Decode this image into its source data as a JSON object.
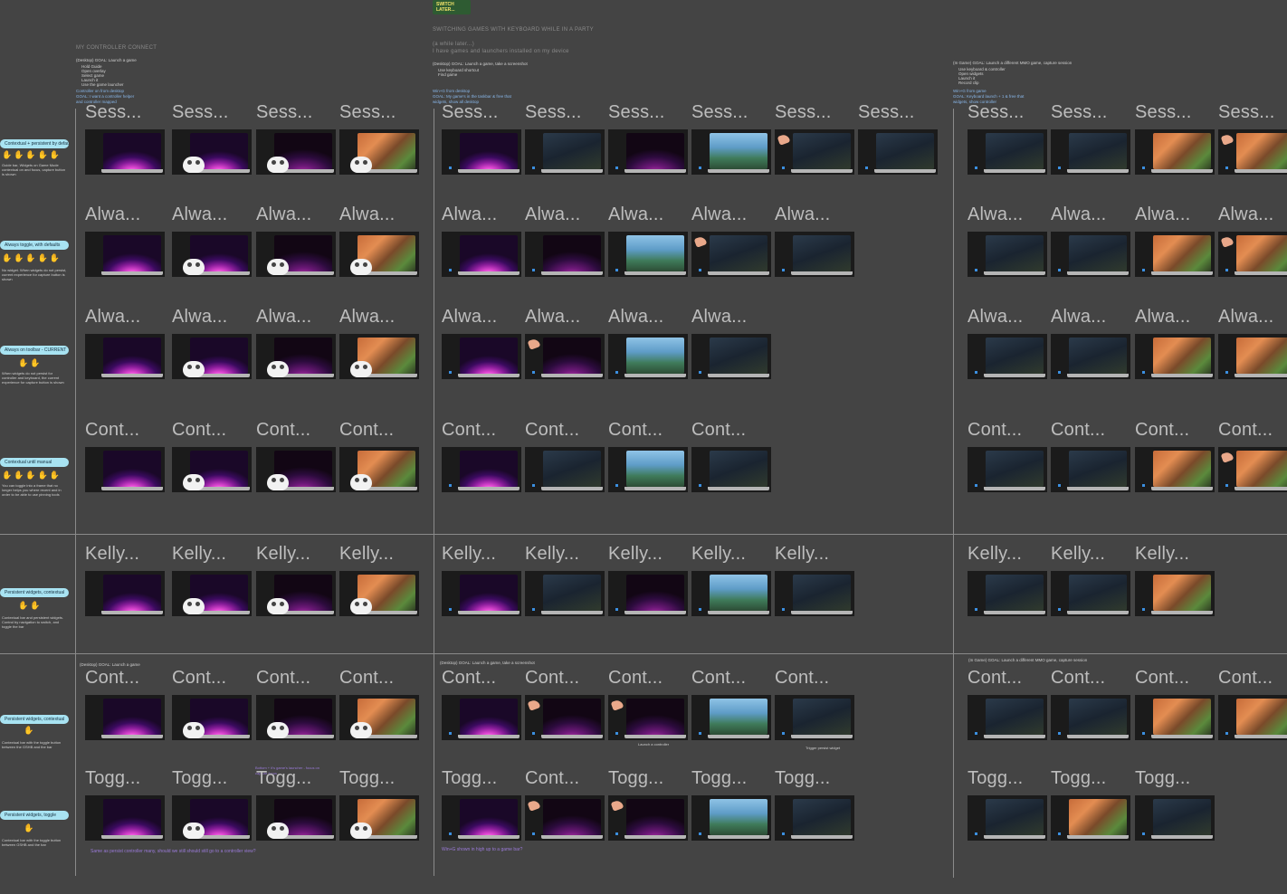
{
  "sections": {
    "controller": {
      "header": "MY CONTROLLER CONNECT",
      "goal": "(Desktop) GOAL: Launch a game",
      "goal_lines": [
        "Hold Guide",
        "Open overlay",
        "Select game",
        "Launch it",
        "Use the game launcher"
      ],
      "entry_note": "Controller on from desktop",
      "entry_note2": "GOAL: I want a controller helper",
      "entry_note3": "and controller mapped"
    },
    "keyboard": {
      "logo": "SWITCH LATER...",
      "header": "SWITCHING GAMES WITH KEYBOARD WHILE IN A PARTY",
      "sub1": "(a while later...)",
      "sub2": "I have games and launchers installed on my device",
      "goal": "(Desktop) GOAL: Launch a game, take a screenshot",
      "goal_lines": [
        "Use keyboard shortcut",
        "Find game"
      ],
      "entry_note": "Win+G from desktop",
      "entry_note2": "GOAL: My game's in the taskbar & free that",
      "entry_note3": "widgets, show all desktop"
    },
    "ingame": {
      "goal": "(In Game) GOAL: Launch a different MMO game, capture session",
      "goal_lines": [
        "Use keyboard & controller",
        "Open widgets",
        "Launch it",
        "Record clip"
      ],
      "entry_note": "Win+G from game",
      "entry_note2": "GOAL: Keyboard launch + 1 & free that",
      "entry_note3": "widgets, show controller"
    }
  },
  "rows": [
    {
      "pill": "Contextual + persistent by default",
      "note": "Guide bar, Widgets on Game Mode contextual on and focus, capture button is shown",
      "titles": [
        "Sess...",
        "Sess...",
        "Sess...",
        "Sess...",
        "Sess...",
        "Sess...",
        "Sess...",
        "Sess...",
        "Sess...",
        "Sess...",
        "Sess...",
        "Sess...",
        "Sess...",
        "Sess..."
      ]
    },
    {
      "pill": "Always toggle, with defaults",
      "note": "No widget. When widgets do not persist, current experience for capture button is shown",
      "titles": [
        "Alwa...",
        "Alwa...",
        "Alwa...",
        "Alwa...",
        "Alwa...",
        "Alwa...",
        "Alwa...",
        "Alwa...",
        "Alwa...",
        "Alwa...",
        "Alwa...",
        "Alwa...",
        "Alwa..."
      ]
    },
    {
      "pill": "Always on toolbar - CURRENT",
      "note": "When widgets do not persist for controller and keyboard, the current experience for capture button is shown",
      "titles": [
        "Alwa...",
        "Alwa...",
        "Alwa...",
        "Alwa...",
        "Alwa...",
        "Alwa...",
        "Alwa...",
        "Alwa...",
        "Alwa...",
        "Alwa...",
        "Alwa...",
        "Alwa..."
      ]
    },
    {
      "pill": "Contextual until manual",
      "note": "You can toggle into a frame that no longer helps you where recent and in order to be able to use pinning tools",
      "titles": [
        "Cont...",
        "Cont...",
        "Cont...",
        "Cont...",
        "Cont...",
        "Cont...",
        "Cont...",
        "Cont...",
        "Cont...",
        "Cont...",
        "Cont...",
        "Cont..."
      ]
    },
    {
      "pill": "Persistent widgets, contextual",
      "note": "Contextual bar and persistent widgets. Control by navigation to switch, and toggle the bar",
      "titles": [
        "Kelly...",
        "Kelly...",
        "Kelly...",
        "Kelly...",
        "Kelly...",
        "Kelly...",
        "Kelly...",
        "Kelly...",
        "Kelly...",
        "Kelly...",
        "Kelly...",
        "Kelly..."
      ]
    },
    {
      "pill": "Persistent widgets, contextual",
      "note": "Contextual bar with the toggle button between the GSHB and the bar",
      "titles": [
        "Cont...",
        "Cont...",
        "Cont...",
        "Cont...",
        "Cont...",
        "Cont...",
        "Cont...",
        "Cont...",
        "Cont...",
        "Cont...",
        "Cont...",
        "Cont...",
        "Cont..."
      ]
    },
    {
      "pill": "Persistent widgets, toggle",
      "note": "Contextual bar with the toggle button between GSHB and the bar",
      "titles": [
        "Togg...",
        "Togg...",
        "Togg...",
        "Togg...",
        "Togg...",
        "Cont...",
        "Togg...",
        "Togg...",
        "Togg...",
        "Togg...",
        "Togg...",
        "Togg..."
      ]
    }
  ],
  "notes": {
    "row7_controller": "Same as persist controller many, should we still should still go to a controller view?",
    "row7_keyboard": "Win+G shown in high up to a game bar?",
    "row6_kb_sub1": "Launch a controller",
    "row6_kb_sub2": "Trigger persist widget",
    "row6_ctl_hint": "Bottom + it's game's launcher - focus on",
    "row6_ctl_hint2": "capture focus"
  }
}
